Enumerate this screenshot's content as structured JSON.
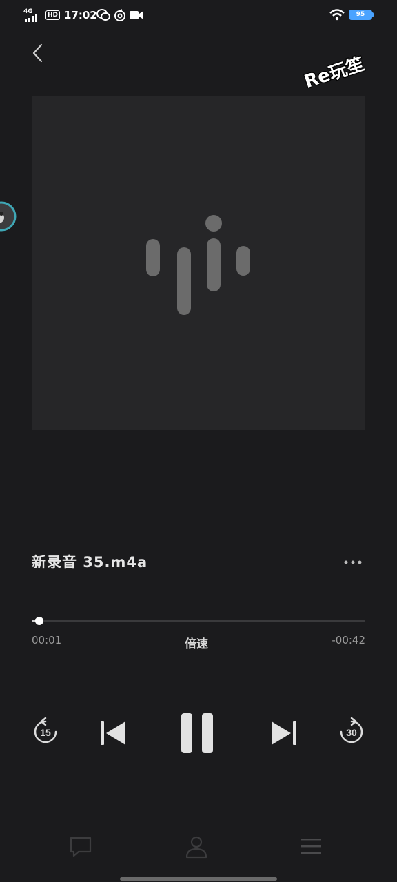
{
  "status_bar": {
    "network": "4G",
    "hd": "HD",
    "time": "17:02",
    "battery": "95"
  },
  "watermark": "Re玩笙",
  "track": {
    "title": "新录音  35.m4a"
  },
  "playback": {
    "elapsed": "00:01",
    "remaining": "-00:42",
    "speed_label": "倍速",
    "progress_fraction": 0.023
  },
  "controls": {
    "rewind_seconds": "15",
    "forward_seconds": "30"
  },
  "colors": {
    "background": "#1b1b1d",
    "cover": "#262628",
    "logo": "#6b6b6b",
    "battery": "#4aa3ff"
  },
  "icons": {
    "back": "chevron-left-icon",
    "more": "more-horizontal-icon",
    "previous": "skip-previous-icon",
    "pause": "pause-icon",
    "next": "skip-next-icon",
    "comment": "comment-icon",
    "profile": "person-icon",
    "playlist": "menu-icon"
  }
}
